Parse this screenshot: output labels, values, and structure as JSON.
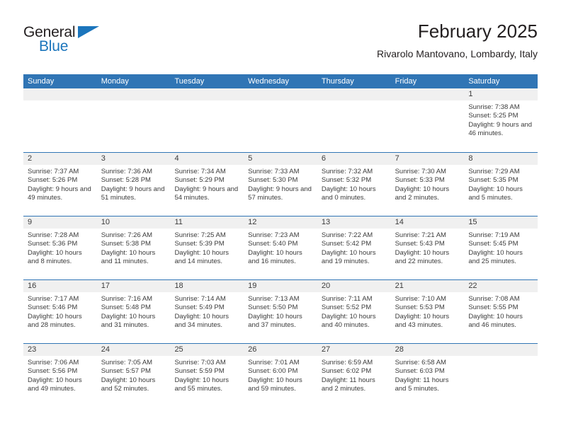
{
  "brand": {
    "name_primary": "General",
    "name_secondary": "Blue",
    "accent_color": "#1b75bc"
  },
  "header": {
    "title": "February 2025",
    "subtitle": "Rivarolo Mantovano, Lombardy, Italy"
  },
  "theme": {
    "header_bar_color": "#3075b5",
    "date_bar_color": "#f0f0f0",
    "text_color": "#3b3b3b"
  },
  "weekdays": [
    "Sunday",
    "Monday",
    "Tuesday",
    "Wednesday",
    "Thursday",
    "Friday",
    "Saturday"
  ],
  "weeks": [
    [
      {
        "empty": true
      },
      {
        "empty": true
      },
      {
        "empty": true
      },
      {
        "empty": true
      },
      {
        "empty": true
      },
      {
        "empty": true
      },
      {
        "day": "1",
        "sunrise": "Sunrise: 7:38 AM",
        "sunset": "Sunset: 5:25 PM",
        "daylight": "Daylight: 9 hours and 46 minutes."
      }
    ],
    [
      {
        "day": "2",
        "sunrise": "Sunrise: 7:37 AM",
        "sunset": "Sunset: 5:26 PM",
        "daylight": "Daylight: 9 hours and 49 minutes."
      },
      {
        "day": "3",
        "sunrise": "Sunrise: 7:36 AM",
        "sunset": "Sunset: 5:28 PM",
        "daylight": "Daylight: 9 hours and 51 minutes."
      },
      {
        "day": "4",
        "sunrise": "Sunrise: 7:34 AM",
        "sunset": "Sunset: 5:29 PM",
        "daylight": "Daylight: 9 hours and 54 minutes."
      },
      {
        "day": "5",
        "sunrise": "Sunrise: 7:33 AM",
        "sunset": "Sunset: 5:30 PM",
        "daylight": "Daylight: 9 hours and 57 minutes."
      },
      {
        "day": "6",
        "sunrise": "Sunrise: 7:32 AM",
        "sunset": "Sunset: 5:32 PM",
        "daylight": "Daylight: 10 hours and 0 minutes."
      },
      {
        "day": "7",
        "sunrise": "Sunrise: 7:30 AM",
        "sunset": "Sunset: 5:33 PM",
        "daylight": "Daylight: 10 hours and 2 minutes."
      },
      {
        "day": "8",
        "sunrise": "Sunrise: 7:29 AM",
        "sunset": "Sunset: 5:35 PM",
        "daylight": "Daylight: 10 hours and 5 minutes."
      }
    ],
    [
      {
        "day": "9",
        "sunrise": "Sunrise: 7:28 AM",
        "sunset": "Sunset: 5:36 PM",
        "daylight": "Daylight: 10 hours and 8 minutes."
      },
      {
        "day": "10",
        "sunrise": "Sunrise: 7:26 AM",
        "sunset": "Sunset: 5:38 PM",
        "daylight": "Daylight: 10 hours and 11 minutes."
      },
      {
        "day": "11",
        "sunrise": "Sunrise: 7:25 AM",
        "sunset": "Sunset: 5:39 PM",
        "daylight": "Daylight: 10 hours and 14 minutes."
      },
      {
        "day": "12",
        "sunrise": "Sunrise: 7:23 AM",
        "sunset": "Sunset: 5:40 PM",
        "daylight": "Daylight: 10 hours and 16 minutes."
      },
      {
        "day": "13",
        "sunrise": "Sunrise: 7:22 AM",
        "sunset": "Sunset: 5:42 PM",
        "daylight": "Daylight: 10 hours and 19 minutes."
      },
      {
        "day": "14",
        "sunrise": "Sunrise: 7:21 AM",
        "sunset": "Sunset: 5:43 PM",
        "daylight": "Daylight: 10 hours and 22 minutes."
      },
      {
        "day": "15",
        "sunrise": "Sunrise: 7:19 AM",
        "sunset": "Sunset: 5:45 PM",
        "daylight": "Daylight: 10 hours and 25 minutes."
      }
    ],
    [
      {
        "day": "16",
        "sunrise": "Sunrise: 7:17 AM",
        "sunset": "Sunset: 5:46 PM",
        "daylight": "Daylight: 10 hours and 28 minutes."
      },
      {
        "day": "17",
        "sunrise": "Sunrise: 7:16 AM",
        "sunset": "Sunset: 5:48 PM",
        "daylight": "Daylight: 10 hours and 31 minutes."
      },
      {
        "day": "18",
        "sunrise": "Sunrise: 7:14 AM",
        "sunset": "Sunset: 5:49 PM",
        "daylight": "Daylight: 10 hours and 34 minutes."
      },
      {
        "day": "19",
        "sunrise": "Sunrise: 7:13 AM",
        "sunset": "Sunset: 5:50 PM",
        "daylight": "Daylight: 10 hours and 37 minutes."
      },
      {
        "day": "20",
        "sunrise": "Sunrise: 7:11 AM",
        "sunset": "Sunset: 5:52 PM",
        "daylight": "Daylight: 10 hours and 40 minutes."
      },
      {
        "day": "21",
        "sunrise": "Sunrise: 7:10 AM",
        "sunset": "Sunset: 5:53 PM",
        "daylight": "Daylight: 10 hours and 43 minutes."
      },
      {
        "day": "22",
        "sunrise": "Sunrise: 7:08 AM",
        "sunset": "Sunset: 5:55 PM",
        "daylight": "Daylight: 10 hours and 46 minutes."
      }
    ],
    [
      {
        "day": "23",
        "sunrise": "Sunrise: 7:06 AM",
        "sunset": "Sunset: 5:56 PM",
        "daylight": "Daylight: 10 hours and 49 minutes."
      },
      {
        "day": "24",
        "sunrise": "Sunrise: 7:05 AM",
        "sunset": "Sunset: 5:57 PM",
        "daylight": "Daylight: 10 hours and 52 minutes."
      },
      {
        "day": "25",
        "sunrise": "Sunrise: 7:03 AM",
        "sunset": "Sunset: 5:59 PM",
        "daylight": "Daylight: 10 hours and 55 minutes."
      },
      {
        "day": "26",
        "sunrise": "Sunrise: 7:01 AM",
        "sunset": "Sunset: 6:00 PM",
        "daylight": "Daylight: 10 hours and 59 minutes."
      },
      {
        "day": "27",
        "sunrise": "Sunrise: 6:59 AM",
        "sunset": "Sunset: 6:02 PM",
        "daylight": "Daylight: 11 hours and 2 minutes."
      },
      {
        "day": "28",
        "sunrise": "Sunrise: 6:58 AM",
        "sunset": "Sunset: 6:03 PM",
        "daylight": "Daylight: 11 hours and 5 minutes."
      },
      {
        "empty": true
      }
    ]
  ]
}
